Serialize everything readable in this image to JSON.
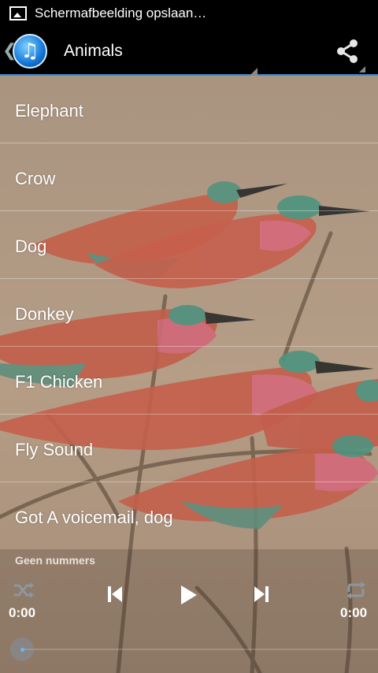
{
  "status_bar": {
    "notification_icon": "image-icon",
    "notification_text": "Schermafbeelding opslaan…"
  },
  "action_bar": {
    "app_icon": "music-note-icon",
    "title": "Animals",
    "share_icon": "share-icon"
  },
  "sounds": [
    {
      "label": "Elephant"
    },
    {
      "label": "Crow"
    },
    {
      "label": "Dog"
    },
    {
      "label": "Donkey"
    },
    {
      "label": "F1 Chicken"
    },
    {
      "label": "Fly Sound"
    },
    {
      "label": "Got A voicemail, dog"
    }
  ],
  "player": {
    "track_status": "Geen nummers",
    "elapsed": "0:00",
    "duration": "0:00",
    "progress": 0,
    "icons": [
      "shuffle-icon",
      "previous-icon",
      "play-icon",
      "next-icon",
      "repeat-icon"
    ]
  },
  "colors": {
    "action_bar_divider": "#3a82c9",
    "seek_accent": "#6ab4ff"
  }
}
